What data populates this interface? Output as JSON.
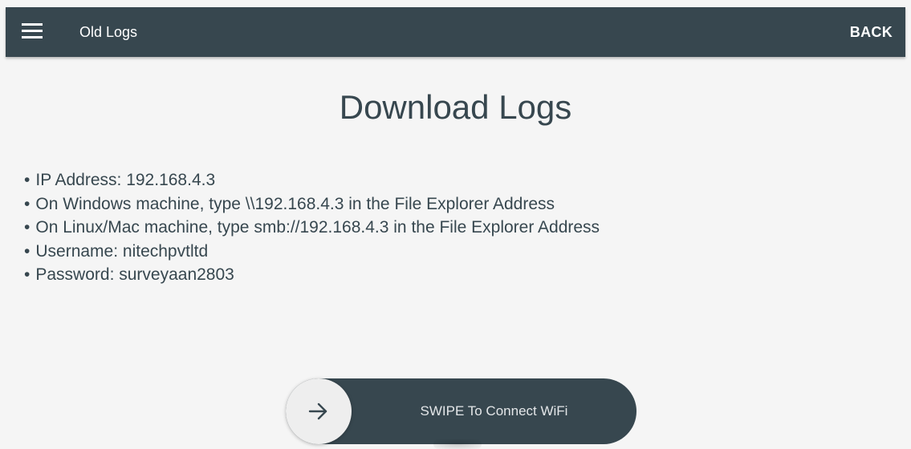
{
  "app_bar": {
    "menu_icon": "hamburger-menu-icon",
    "title": "Old Logs",
    "back_label": "BACK",
    "background_color": "#37474f"
  },
  "page": {
    "heading": "Download Logs",
    "bullet": "•",
    "info_items": [
      "IP Address: 192.168.4.3",
      "On Windows machine, type \\\\192.168.4.3 in the File Explorer Address",
      "On Linux/Mac machine, type smb://192.168.4.3 in the File Explorer Address",
      "Username: nitechpvtltd",
      "Password: surveyaan2803"
    ]
  },
  "swipe_control": {
    "icon": "arrow-right-icon",
    "label": "SWIPE To Connect WiFi"
  }
}
